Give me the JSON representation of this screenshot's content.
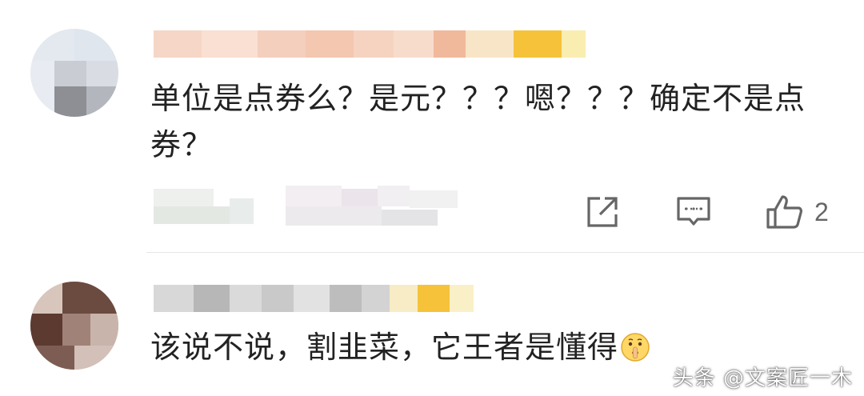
{
  "comments": [
    {
      "text": "单位是点券么？是元？？？嗯？？？确定不是点券？",
      "like_count": "2",
      "actions": {
        "share_icon": "share-external-icon",
        "reply_icon": "comment-reply-icon",
        "like_icon": "thumbs-up-icon"
      }
    },
    {
      "text": "该说不说，割韭菜，它王者是懂得",
      "emoji_icon": "shushing-face-emoji-icon"
    }
  ],
  "watermark": {
    "text": "头条 @文案匠一木"
  },
  "colors": {
    "background": "#ffffff",
    "text": "#222222",
    "icon": "#666666",
    "divider": "#e6e6e6",
    "mosaic_highlight": "#f5c23a"
  }
}
